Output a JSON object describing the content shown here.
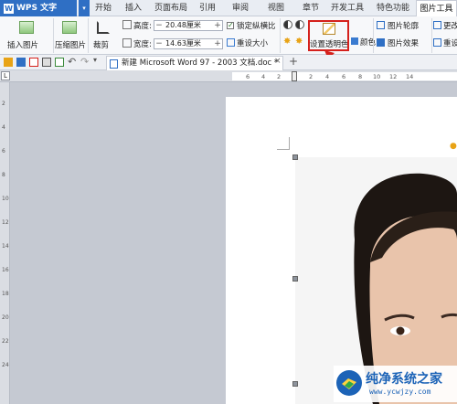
{
  "app": {
    "title": "WPS 文字"
  },
  "menu": {
    "tabs": [
      "开始",
      "插入",
      "页面布局",
      "引用",
      "审阅",
      "视图",
      "章节",
      "开发工具",
      "特色功能",
      "图片工具"
    ],
    "active": "图片工具"
  },
  "ribbon": {
    "insert_picture": "插入图片",
    "compress": "压缩图片",
    "crop": "裁剪",
    "height_label": "高度:",
    "height_value": "20.48厘米",
    "width_label": "宽度:",
    "width_value": "14.63厘米",
    "lock_ratio": "锁定纵横比",
    "reset_size": "重设大小",
    "set_transparent": "设置透明色",
    "color": "颜色",
    "outline": "图片轮廓",
    "effects": "图片效果",
    "change": "更改",
    "reset": "重设"
  },
  "document": {
    "tab_title": "新建 Microsoft Word 97 - 2003 文档.doc *",
    "new_tab": "+"
  },
  "ruler": {
    "corner": "L",
    "h_ticks": [
      "6",
      "4",
      "2",
      "2",
      "4",
      "6",
      "8",
      "10",
      "12",
      "14"
    ],
    "v_ticks": [
      "2",
      "4",
      "6",
      "8",
      "10",
      "12",
      "14",
      "16",
      "18",
      "20",
      "22",
      "24"
    ]
  },
  "watermark": {
    "title": "纯净系统之家",
    "url": "www.ycwjzy.com"
  }
}
